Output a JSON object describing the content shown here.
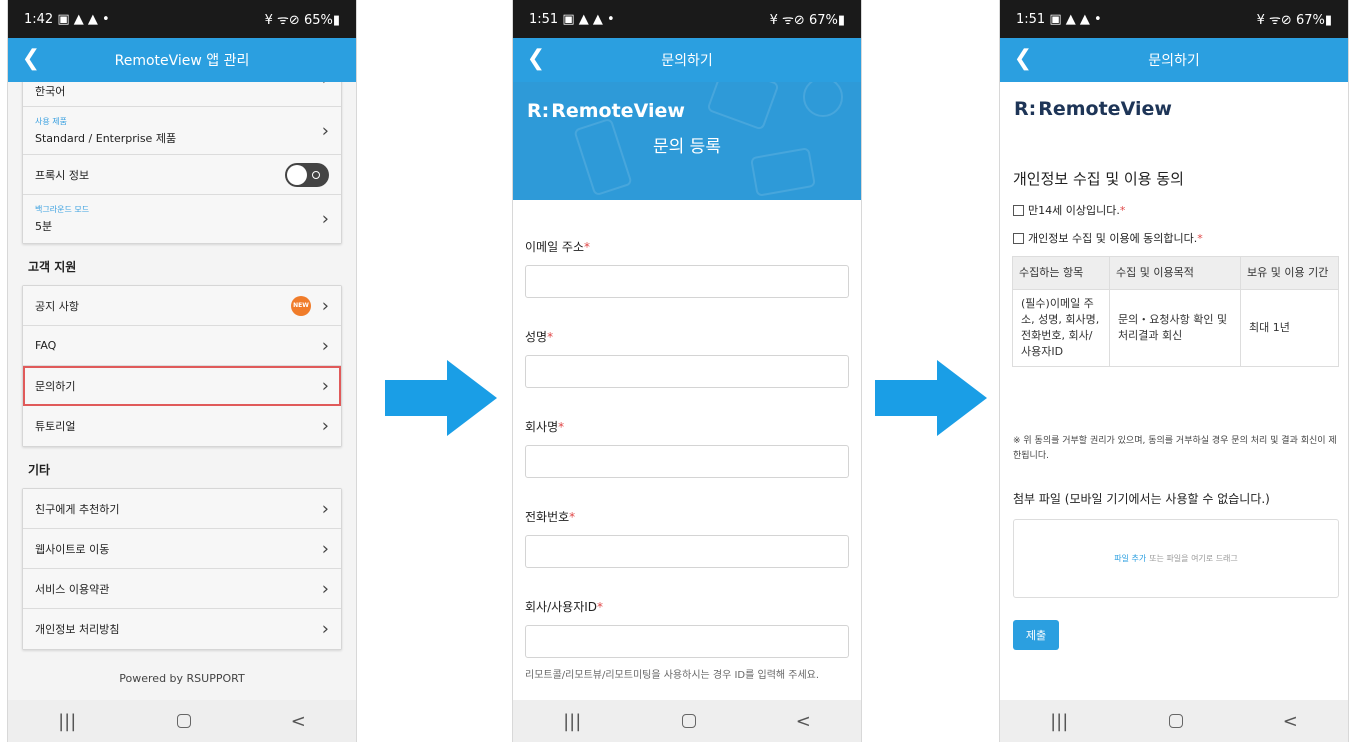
{
  "phone1": {
    "status": {
      "time": "1:42 ▣ ▲ ▲ •",
      "right": "¥ ᯤ⊘ 65%▮"
    },
    "title": "RemoteView 앱 관리",
    "top_cut_item": "한국어",
    "rows_app": [
      {
        "sub": "사용 제품",
        "label": "Standard / Enterprise 제품"
      },
      {
        "label": "프록시 정보"
      },
      {
        "sub": "백그라운드 모드",
        "label": "5분"
      }
    ],
    "section_support": "고객 지원",
    "support_items": [
      "공지 사항",
      "FAQ",
      "문의하기",
      "튜토리얼"
    ],
    "new_badge": "NEW",
    "section_other": "기타",
    "other_items": [
      "친구에게 추천하기",
      "웹사이트로 이동",
      "서비스 이용약관",
      "개인정보 처리방침"
    ],
    "powered": "Powered by RSUPPORT"
  },
  "phone2": {
    "status": {
      "time": "1:51 ▣ ▲ ▲ •",
      "right": "¥ ᯤ⊘ 67%▮"
    },
    "title": "문의하기",
    "logo_mark": "R:",
    "logo_text": "RemoteView",
    "hero_title": "문의 등록",
    "fields": [
      "이메일 주소",
      "성명",
      "회사명",
      "전화번호",
      "회사/사용자ID"
    ],
    "required_mark": "*",
    "help_text": "리모트콜/리모트뷰/리모트미팅을 사용하시는 경우 ID를 입력해 주세요."
  },
  "phone3": {
    "status": {
      "time": "1:51 ▣ ▲ ▲ •",
      "right": "¥ ᯤ⊘ 67%▮"
    },
    "title": "문의하기",
    "logo_mark": "R:",
    "logo_text": "RemoteView",
    "consent_title": "개인정보 수집 및 이용 동의",
    "check_age": "만14세 이상입니다.",
    "check_agree": "개인정보 수집 및 이용에 동의합니다.",
    "table_headers": [
      "수집하는 항목",
      "수집 및 이용목적",
      "보유 및 이용 기간"
    ],
    "table_row": [
      "(필수)이메일 주소, 성명, 회사명, 전화번호, 회사/사용자ID",
      "문의・요청사항 확인 및 처리결과 회신",
      "최대 1년"
    ],
    "notice": "※ 위 동의를 거부할 권리가 있으며, 동의를 거부하실 경우 문의 처리 및 결과 회신이 제한됩니다.",
    "attach_title": "첨부 파일 (모바일 기기에서는 사용할 수 없습니다.)",
    "add_file": "파일 추가",
    "drop_hint": "또는 파일을 여기로 드래그",
    "submit": "제출"
  },
  "nav": {
    "recents": "|||",
    "back": "<"
  },
  "colors": {
    "accent": "#2b9fe0",
    "arrow": "#1a9ee6",
    "required": "#e04848"
  }
}
